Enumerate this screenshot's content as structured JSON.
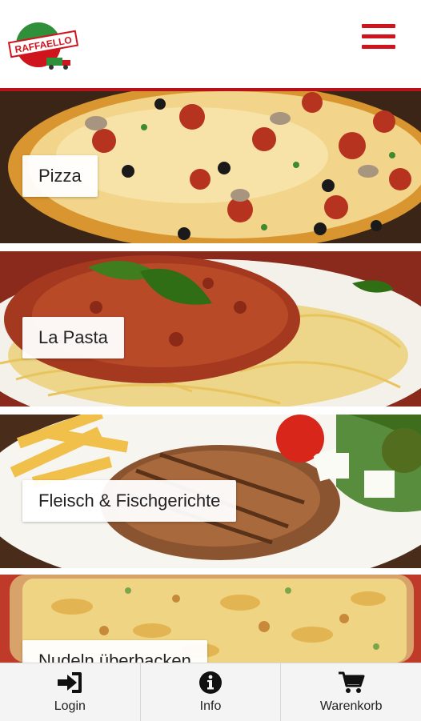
{
  "header": {
    "logo_text": "RAFFAELLO",
    "menu_icon": "hamburger-menu-icon",
    "accent_color": "#d0141e"
  },
  "categories": [
    {
      "label": "Pizza"
    },
    {
      "label": "La Pasta"
    },
    {
      "label": "Fleisch & Fischgerichte"
    },
    {
      "label": "Nudeln überbacken"
    }
  ],
  "bottom_nav": {
    "login": {
      "label": "Login",
      "icon": "login-icon"
    },
    "info": {
      "label": "Info",
      "icon": "info-icon"
    },
    "cart": {
      "label": "Warenkorb",
      "icon": "shopping-cart-icon"
    }
  }
}
